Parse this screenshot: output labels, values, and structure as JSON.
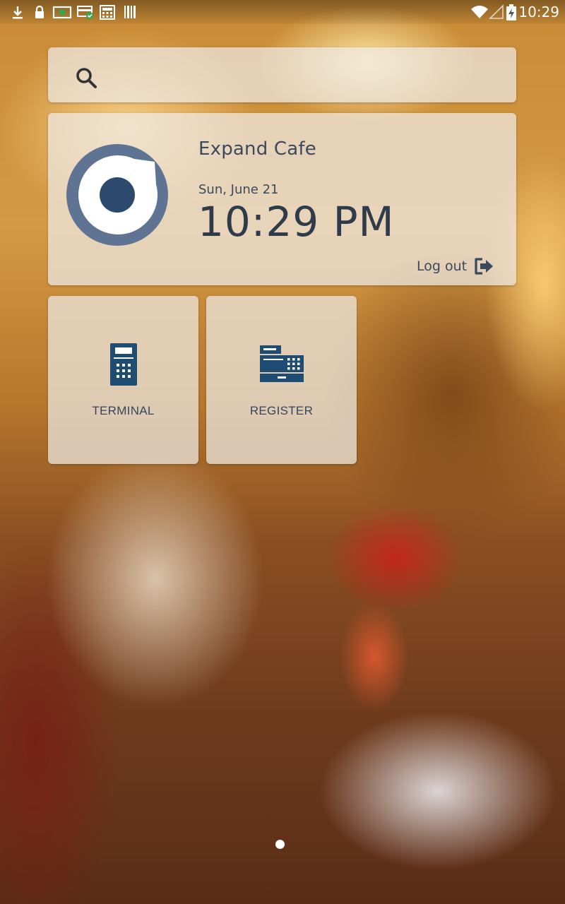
{
  "status_bar": {
    "time": "10:29",
    "left_icons": [
      "download-icon",
      "lock-icon",
      "screen-cast-icon",
      "card-check-icon",
      "calculator-icon",
      "barcode-icon"
    ],
    "right_icons": [
      "wifi-icon",
      "signal-icon",
      "battery-charging-icon"
    ]
  },
  "search": {
    "placeholder": ""
  },
  "store": {
    "name": "Expand Cafe",
    "date": "Sun, June 21",
    "time": "10:29 PM",
    "logout_label": "Log out"
  },
  "tiles": [
    {
      "label": "TERMINAL",
      "icon": "card-terminal-icon"
    },
    {
      "label": "REGISTER",
      "icon": "cash-register-icon"
    }
  ],
  "pager": {
    "current_page": 1,
    "page_count": 1
  },
  "colors": {
    "accent": "#1f4c73",
    "logo_ring": "#5f7492",
    "text": "#3a4a5c"
  }
}
